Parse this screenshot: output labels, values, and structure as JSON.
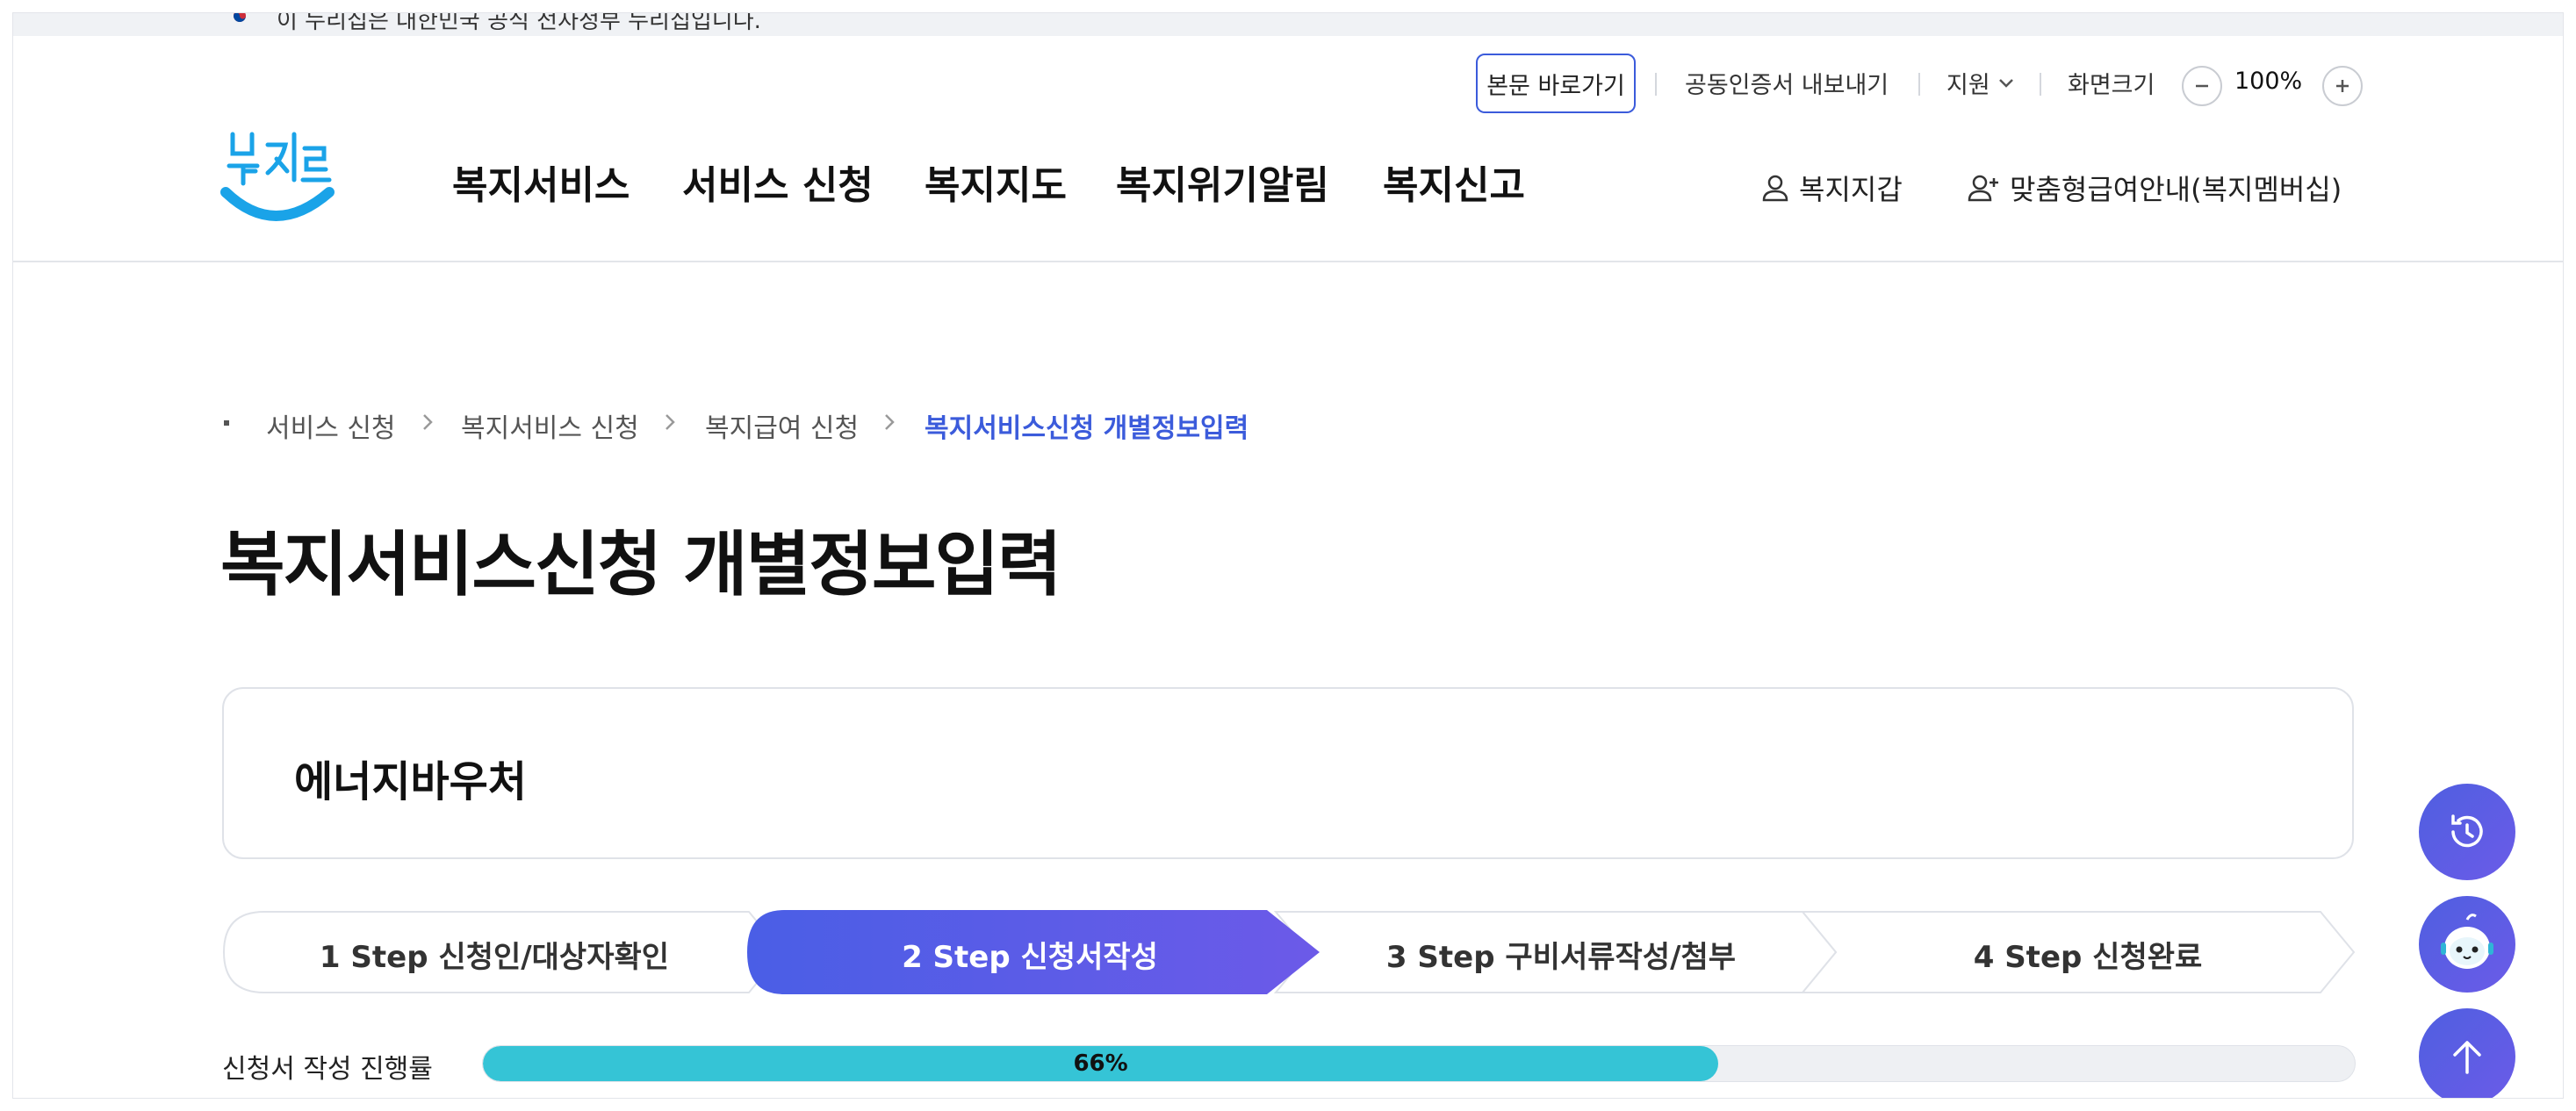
{
  "gov_bar": {
    "text": "이 누리집은 대한민국 공식 전자정부 누리집입니다."
  },
  "util": {
    "skip_label": "본문 바로가기",
    "cert_export_label": "공동인증서 내보내기",
    "support_label": "지원",
    "screen_size_label": "화면크기",
    "zoom_value": "100%"
  },
  "logo": {
    "text": "복지로"
  },
  "gnb": {
    "items": [
      {
        "label": "복지서비스"
      },
      {
        "label": "서비스 신청"
      },
      {
        "label": "복지지도"
      },
      {
        "label": "복지위기알림"
      },
      {
        "label": "복지신고"
      }
    ],
    "wallet_label": "복지지갑",
    "membership_label": "맞춤형급여안내(복지멤버십)"
  },
  "breadcrumb": {
    "items": [
      {
        "label": "서비스 신청"
      },
      {
        "label": "복지서비스 신청"
      },
      {
        "label": "복지급여 신청"
      },
      {
        "label": "복지서비스신청 개별정보입력"
      }
    ]
  },
  "page_title": "복지서비스신청 개별정보입력",
  "service_name": "에너지바우처",
  "steps": {
    "active_index": 1,
    "items": [
      {
        "label": "1 Step 신청인/대상자확인"
      },
      {
        "label": "2 Step 신청서작성"
      },
      {
        "label": "3 Step 구비서류작성/첨부"
      },
      {
        "label": "4 Step 신청완료"
      }
    ]
  },
  "progress": {
    "label": "신청서 작성 진행률",
    "value_text": "66%",
    "value": 0.66
  },
  "colors": {
    "accent": "#3b5bdb",
    "step_active_start": "#4a5ee6",
    "step_active_end": "#6c5ae8",
    "progress_fill": "#35c4d6",
    "logo_blue": "#1aa3e8"
  },
  "icons": {
    "recent": "history-clock-icon",
    "chatbot": "chatbot-mascot-icon",
    "top": "arrow-up-icon"
  }
}
